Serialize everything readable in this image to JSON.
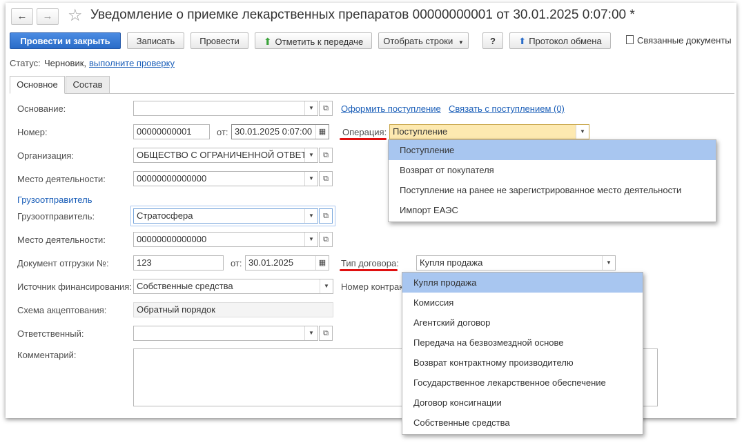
{
  "window": {
    "title": "Уведомление о приемке лекарственных препаратов 00000000001 от 30.01.2025 0:07:00 *",
    "nav_back": "←",
    "nav_forward": "→",
    "star": "☆"
  },
  "toolbar": {
    "post_close": "Провести и закрыть",
    "save": "Записать",
    "post": "Провести",
    "mark_transfer": "Отметить к передаче",
    "select_rows": "Отобрать строки",
    "help": "?",
    "exchange_log": "Протокол обмена",
    "related_docs": "Связанные документы"
  },
  "status": {
    "label": "Статус:",
    "value": "Черновик,",
    "link": "выполните проверку"
  },
  "tabs": [
    "Основное",
    "Состав"
  ],
  "form": {
    "osnovanie_label": "Основание:",
    "osnovanie_value": "",
    "link_oformit": "Оформить поступление",
    "link_svyazat": "Связать с поступлением (0)",
    "nomer_label": "Номер:",
    "nomer_value": "00000000001",
    "ot_label": "от:",
    "date_value": "30.01.2025  0:07:00",
    "operacia_label": "Операция:",
    "operacia_value": "Поступление",
    "org_label": "Организация:",
    "org_value": "ОБЩЕСТВО С ОГРАНИЧЕННОЙ ОТВЕТ",
    "mesto_label": "Место деятельности:",
    "mesto_value": "00000000000000",
    "gruz_section": "Грузоотправитель",
    "gruz_label": "Грузоотправитель:",
    "gruz_value": "Стратосфера",
    "mesto2_label": "Место деятельности:",
    "mesto2_value": "00000000000000",
    "doc_label": "Документ отгрузки №:",
    "doc_value": "123",
    "ot2_label": "от:",
    "doc_date": "30.01.2025",
    "tip_label": "Тип договора:",
    "tip_value": "Купля продажа",
    "istochnik_label": "Источник финансирования:",
    "istochnik_value": "Собственные средства",
    "nomer_kontrakta_label": "Номер контрак",
    "schema_label": "Схема акцептования:",
    "schema_value": "Обратный порядок",
    "otv_label": "Ответственный:",
    "otv_value": "",
    "comment_label": "Комментарий:"
  },
  "operation_options": [
    "Поступление",
    "Возврат от покупателя",
    "Поступление на ранее не зарегистрированное место деятельности",
    "Импорт ЕАЭС"
  ],
  "contract_options": [
    "Купля продажа",
    "Комиссия",
    "Агентский договор",
    "Передача на безвозмездной основе",
    "Возврат контрактному производителю",
    "Государственное лекарственное обеспечение",
    "Договор консигнации",
    "Собственные средства"
  ],
  "icons": {
    "dropdown": "▼",
    "open": "⧉",
    "calendar": "▦",
    "arrow_up": "⬆",
    "doc": "🗎"
  },
  "colors": {
    "primary": "#2a6cc8",
    "link": "#1a5eb8",
    "highlight": "#fde9b0",
    "selected_item": "#a8c6f0",
    "annotation": "#e01010"
  }
}
